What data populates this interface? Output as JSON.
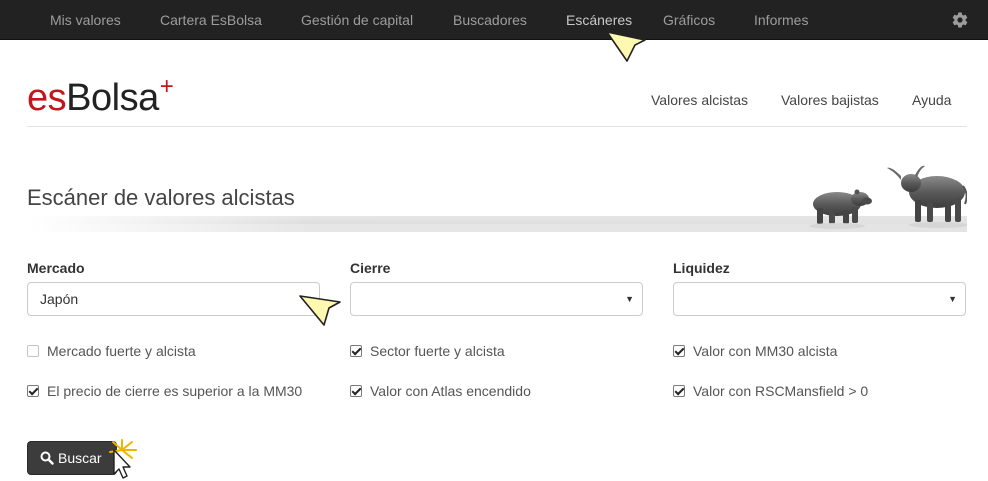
{
  "topnav": {
    "items": [
      {
        "label": "Mis valores"
      },
      {
        "label": "Cartera EsBolsa"
      },
      {
        "label": "Gestión de capital"
      },
      {
        "label": "Buscadores"
      },
      {
        "label": "Escáneres",
        "active": true
      },
      {
        "label": "Gráficos"
      },
      {
        "label": "Informes"
      }
    ],
    "settings_icon": "gear-icon",
    "background": "#222222",
    "text_color": "#9d9d9d"
  },
  "brand": {
    "prefix": "es",
    "name": "Bolsa",
    "suffix": "+",
    "accent": "#c0161c"
  },
  "subnav": {
    "items": [
      {
        "label": "Valores alcistas"
      },
      {
        "label": "Valores bajistas"
      },
      {
        "label": "Ayuda"
      }
    ]
  },
  "page": {
    "title": "Escáner de valores alcistas",
    "banner_image": "bear-and-bull-illustration"
  },
  "form": {
    "mercado": {
      "label": "Mercado",
      "value": "Japón"
    },
    "cierre": {
      "label": "Cierre",
      "value": ""
    },
    "liquidez": {
      "label": "Liquidez",
      "value": ""
    },
    "checkboxes": [
      {
        "label": "Mercado fuerte y alcista",
        "checked": false
      },
      {
        "label": "Sector fuerte y alcista",
        "checked": true
      },
      {
        "label": "Valor con MM30 alcista",
        "checked": true
      },
      {
        "label": "El precio de cierre es superior a la MM30",
        "checked": true
      },
      {
        "label": "Valor con Atlas encendido",
        "checked": true
      },
      {
        "label": "Valor con RSCMansfield > 0",
        "checked": true
      }
    ],
    "submit": {
      "label": "Buscar",
      "icon": "search-icon"
    }
  }
}
